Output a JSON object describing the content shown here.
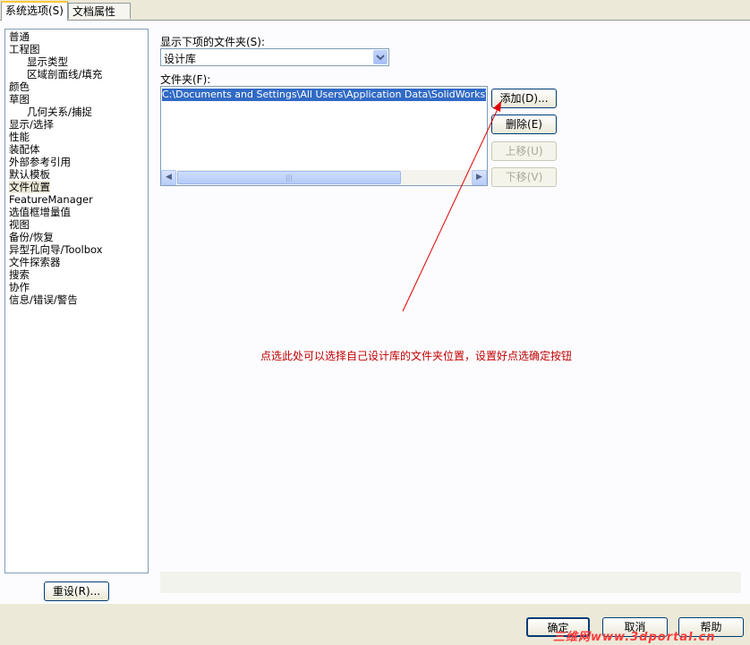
{
  "tabs": [
    {
      "label": "系统选项(S)"
    },
    {
      "label": "文档属性(D)"
    }
  ],
  "tree": {
    "items": [
      {
        "label": "普通",
        "level": 1
      },
      {
        "label": "工程图",
        "level": 1
      },
      {
        "label": "显示类型",
        "level": 2
      },
      {
        "label": "区域剖面线/填充",
        "level": 2
      },
      {
        "label": "颜色",
        "level": 1
      },
      {
        "label": "草图",
        "level": 1
      },
      {
        "label": "几何关系/捕捉",
        "level": 2
      },
      {
        "label": "显示/选择",
        "level": 1
      },
      {
        "label": "性能",
        "level": 1
      },
      {
        "label": "装配体",
        "level": 1
      },
      {
        "label": "外部参考引用",
        "level": 1
      },
      {
        "label": "默认模板",
        "level": 1
      },
      {
        "label": "文件位置",
        "level": 1,
        "selected": true
      },
      {
        "label": "FeatureManager",
        "level": 1
      },
      {
        "label": "选值框增量值",
        "level": 1
      },
      {
        "label": "视图",
        "level": 1
      },
      {
        "label": "备份/恢复",
        "level": 1
      },
      {
        "label": "异型孔向导/Toolbox",
        "level": 1
      },
      {
        "label": "文件探索器",
        "level": 1
      },
      {
        "label": "搜索",
        "level": 1
      },
      {
        "label": "协作",
        "level": 1
      },
      {
        "label": "信息/错误/警告",
        "level": 1
      }
    ],
    "reset_label": "重设(R)..."
  },
  "folders": {
    "show_label": "显示下项的文件夹(S):",
    "show_value": "设计库",
    "folder_label": "文件夹(F):",
    "entry": "C:\\Documents and Settings\\All Users\\Application Data\\SolidWorks\\SolidWor",
    "add_label": "添加(D)...",
    "delete_label": "删除(E)",
    "up_label": "上移(U)",
    "down_label": "下移(V)"
  },
  "annotation": "点选此处可以选择自己设计库的文件夹位置，设置好点选确定按钮",
  "footer": {
    "ok_label": "确定",
    "cancel_label": "取消",
    "help_label": "帮助"
  },
  "watermark": "三维网www.3dportal.cn",
  "colors": {
    "annotation": "#c00000",
    "arrow": "#e00000",
    "selection": "#316ac5"
  }
}
